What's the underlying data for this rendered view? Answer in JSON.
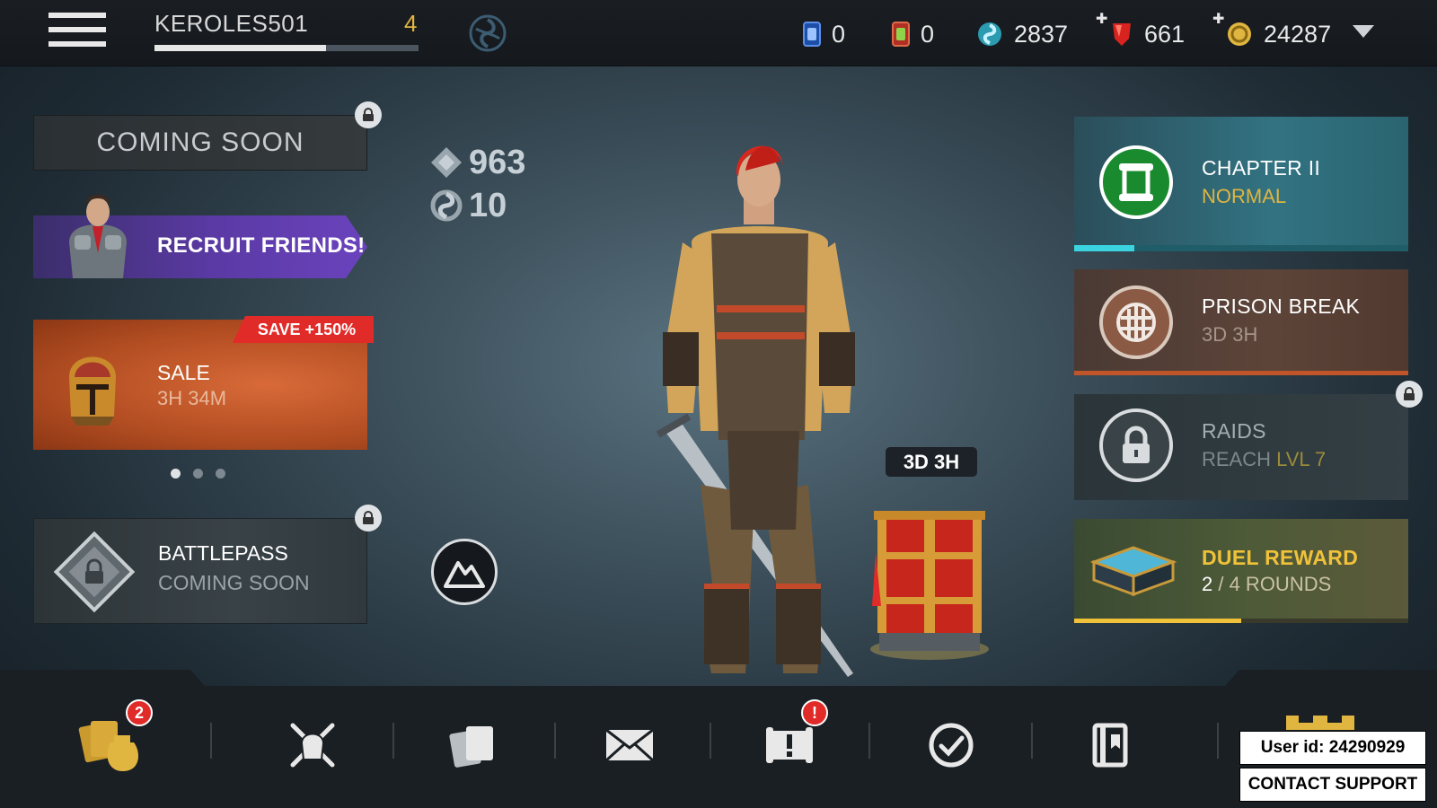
{
  "header": {
    "player_name": "KEROLES501",
    "level": "4",
    "xp_progress": 0.65,
    "currencies": [
      {
        "name": "blue-card",
        "value": "0"
      },
      {
        "name": "green-card",
        "value": "0"
      },
      {
        "name": "spirit",
        "value": "2837"
      },
      {
        "name": "ruby",
        "value": "661"
      },
      {
        "name": "gold",
        "value": "24287"
      }
    ]
  },
  "left": {
    "coming_soon": "COMING SOON",
    "recruit": "RECRUIT FRIENDS!",
    "sale": {
      "tag": "SAVE +150%",
      "title": "SALE",
      "timer": "3H 34M"
    },
    "battlepass": {
      "title": "BATTLEPASS",
      "subtitle": "COMING SOON"
    }
  },
  "stats": {
    "power": "963",
    "spirit_level": "10"
  },
  "chest": {
    "timer": "3D 3H"
  },
  "right": {
    "chapter": {
      "title": "CHAPTER II",
      "subtitle": "NORMAL",
      "progress": 0.18
    },
    "prison": {
      "title": "PRISON BREAK",
      "subtitle": "3D 3H"
    },
    "raids": {
      "title": "RAIDS",
      "subtitle_prefix": "REACH ",
      "subtitle_highlight": "LVL 7"
    },
    "duel": {
      "title": "DUEL REWARD",
      "current": "2",
      "rest": " / 4 ROUNDS",
      "progress": 0.5
    }
  },
  "bottom": {
    "nav": [
      "loot",
      "battle",
      "cards",
      "mail",
      "events",
      "quests",
      "codex",
      "castle"
    ],
    "loot_badge": "2",
    "events_badge": "!",
    "user_id": "User id: 24290929",
    "contact": "CONTACT SUPPORT"
  },
  "colors": {
    "gold": "#e0b540",
    "teal": "#3bd3e0",
    "red": "#e02b28",
    "purple": "#5b3aa5"
  }
}
